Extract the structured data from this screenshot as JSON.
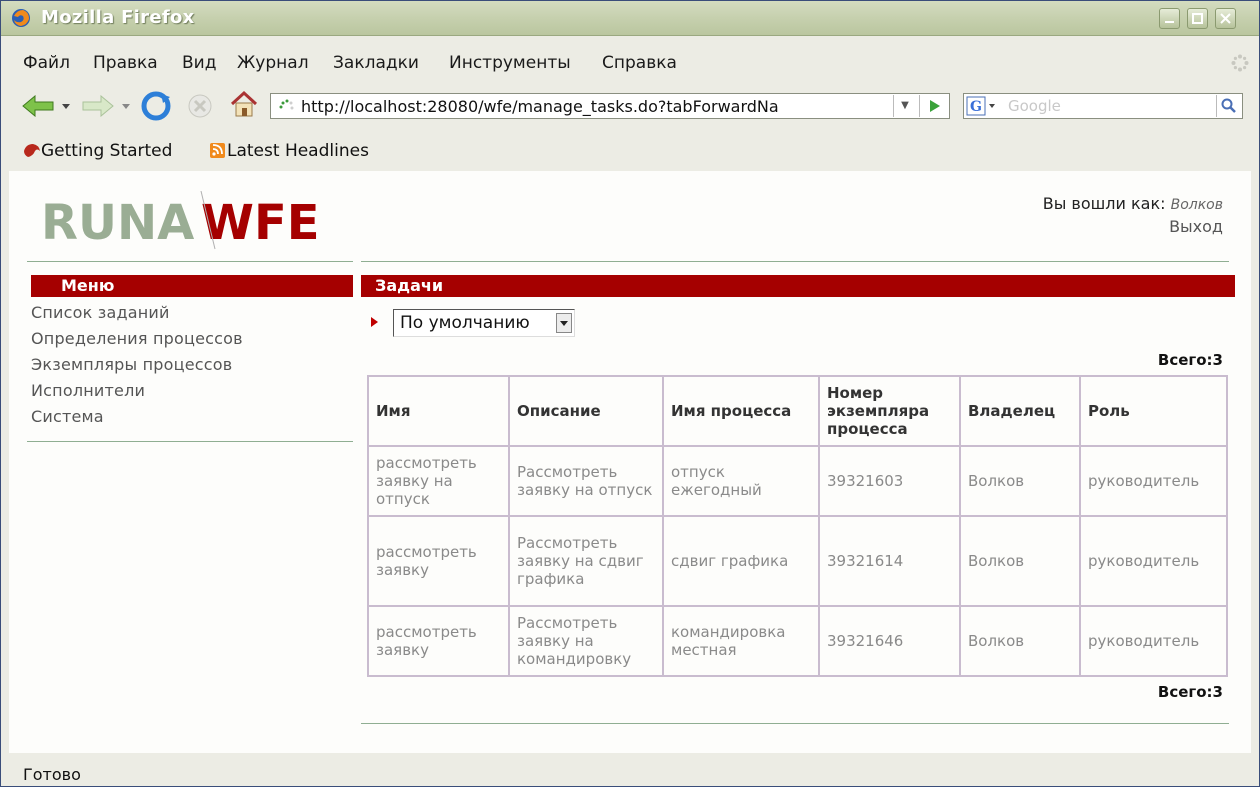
{
  "window": {
    "title": "Mozilla Firefox"
  },
  "menubar": [
    {
      "label": "Файл"
    },
    {
      "label": "Правка"
    },
    {
      "label": "Вид"
    },
    {
      "label": "Журнал"
    },
    {
      "label": "Закладки"
    },
    {
      "label": "Инструменты"
    },
    {
      "label": "Справка"
    }
  ],
  "navbar": {
    "url": "http://localhost:28080/wfe/manage_tasks.do?tabForwardNa",
    "search_placeholder": "Google"
  },
  "bookmarks": [
    {
      "label": "Getting Started",
      "icon": "firefox-icon"
    },
    {
      "label": "Latest Headlines",
      "icon": "rss-icon"
    }
  ],
  "header": {
    "logo_left": "RUNA",
    "logo_right": "WFE",
    "logged_in_label": "Вы вошли как:",
    "user_name": "Волков",
    "logout_label": "Выход"
  },
  "sidebar": {
    "title": "Меню",
    "items": [
      {
        "label": "Список заданий"
      },
      {
        "label": "Определения процессов"
      },
      {
        "label": "Экземпляры процессов"
      },
      {
        "label": "Исполнители"
      },
      {
        "label": "Система"
      }
    ]
  },
  "main": {
    "title": "Задачи",
    "filter_value": "По умолчанию",
    "total_top": "Всего:3",
    "total_bottom": "Всего:3",
    "columns": [
      "Имя",
      "Описание",
      "Имя процесса",
      "Номер экземпляра процесса",
      "Владелец",
      "Роль"
    ],
    "rows": [
      [
        "рассмотреть заявку на отпуск",
        "Рассмотреть заявку на отпуск",
        "отпуск ежегодный",
        "39321603",
        "Волков",
        "руководитель"
      ],
      [
        "рассмотреть заявку",
        "Рассмотреть заявку на сдвиг графика",
        "сдвиг графика",
        "39321614",
        "Волков",
        "руководитель"
      ],
      [
        "рассмотреть заявку",
        "Рассмотреть заявку на командировку",
        "командировка местная",
        "39321646",
        "Волков",
        "руководитель"
      ]
    ]
  },
  "status": {
    "text": "Готово"
  },
  "colors": {
    "accent_red": "#a50000",
    "divider_green": "#8fae92",
    "table_border": "#c9bccf"
  }
}
